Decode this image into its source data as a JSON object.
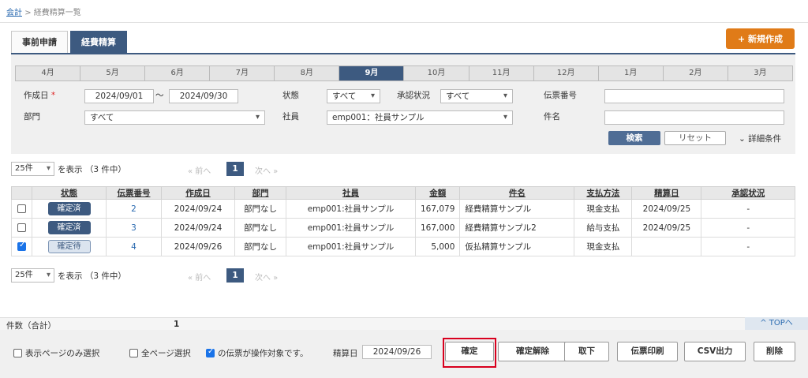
{
  "breadcrumb": {
    "root": "会計",
    "sep": ">",
    "current": "経費精算一覧"
  },
  "tabs": [
    "事前申請",
    "経費精算"
  ],
  "new_button": "+ 新規作成",
  "months": [
    "4月",
    "5月",
    "6月",
    "7月",
    "8月",
    "9月",
    "10月",
    "11月",
    "12月",
    "1月",
    "2月",
    "3月"
  ],
  "active_month": "9月",
  "filters": {
    "created_label": "作成日",
    "required_mark": "*",
    "date_from": "2024/09/01",
    "tilde": "〜",
    "date_to": "2024/09/30",
    "status_label": "状態",
    "status_value": "すべて",
    "approval_label": "承認状況",
    "approval_value": "すべて",
    "slip_label": "伝票番号",
    "slip_value": "",
    "dept_label": "部門",
    "dept_value": "すべて",
    "employee_label": "社員",
    "employee_value": "emp001：社員サンプル",
    "subject_label": "件名",
    "subject_value": "",
    "search_button": "検索",
    "reset_button": "リセット",
    "detail_label": "詳細条件",
    "detail_icon": "chevron-down-icon"
  },
  "pager": {
    "per_page": "25件",
    "summary": "を表示 （3 件中）",
    "prev": "« 前へ",
    "current": "1",
    "next": "次へ »"
  },
  "table": {
    "headers": [
      "状態",
      "伝票番号",
      "作成日",
      "部門",
      "社員",
      "金額",
      "件名",
      "支払方法",
      "精算日",
      "承認状況"
    ],
    "rows": [
      {
        "checked": false,
        "status": "確定済",
        "status_kind": "done",
        "slip": "2",
        "created": "2024/09/24",
        "dept": "部門なし",
        "employee": "emp001:社員サンプル",
        "amount": "167,079",
        "subject": "経費精算サンプル",
        "payment": "現金支払",
        "settle": "2024/09/25",
        "approval": "-"
      },
      {
        "checked": false,
        "status": "確定済",
        "status_kind": "done",
        "slip": "3",
        "created": "2024/09/24",
        "dept": "部門なし",
        "employee": "emp001:社員サンプル",
        "amount": "167,000",
        "subject": "経費精算サンプル2",
        "payment": "給与支払",
        "settle": "2024/09/25",
        "approval": "-"
      },
      {
        "checked": true,
        "status": "確定待",
        "status_kind": "wait",
        "slip": "4",
        "created": "2024/09/26",
        "dept": "部門なし",
        "employee": "emp001:社員サンプル",
        "amount": "5,000",
        "subject": "仮払精算サンプル",
        "payment": "現金支払",
        "settle": "",
        "approval": "-"
      }
    ]
  },
  "footer": {
    "count_label": "件数（合計）",
    "count_value": "1",
    "top_link": "^ TOPへ",
    "page_only": "表示ページのみ選択",
    "all_pages": "全ページ選択",
    "target_text": "の伝票が操作対象です。",
    "settle_label": "精算日",
    "settle_value": "2024/09/26",
    "buttons": [
      "確定",
      "確定解除",
      "取下",
      "伝票印刷",
      "CSV出力",
      "削除"
    ]
  },
  "colors": {
    "accent": "#3d5a80",
    "new_button": "#e07b18",
    "highlight": "#d8001e"
  }
}
